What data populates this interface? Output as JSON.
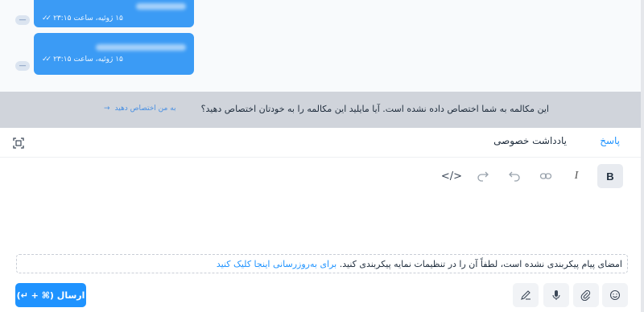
{
  "messages": [
    {
      "meta": "۱۵ ژوئیه، ساعت ۲۳:۱۵"
    },
    {
      "meta": "۱۵ ژوئیه، ساعت ۲۳:۱۵"
    }
  ],
  "avatar_symbol": "—",
  "banner": {
    "text": "این مکالمه به شما اختصاص داده نشده است. آیا مایلید این مکالمه را به خودتان اختصاص دهید؟",
    "assign_link": "به من اختصاص دهید",
    "assign_arrow": "→"
  },
  "tabs": {
    "reply": "پاسخ",
    "private_note": "یادداشت خصوصی"
  },
  "toolbar": {
    "bold": "B",
    "italic": "I",
    "code": "</>"
  },
  "signature": {
    "text": "امضای پیام پیکربندی نشده است، لطفاً آن را در تنظیمات نمایه پیکربندی کنید.",
    "link": "برای به‌روزرسانی اینجا کلیک کنید"
  },
  "send_button": "ارسال (⌘ + ↵)",
  "colors": {
    "accent": "#1f93ff",
    "bubble": "#3b9bf5",
    "banner_bg": "#d0d4db"
  }
}
